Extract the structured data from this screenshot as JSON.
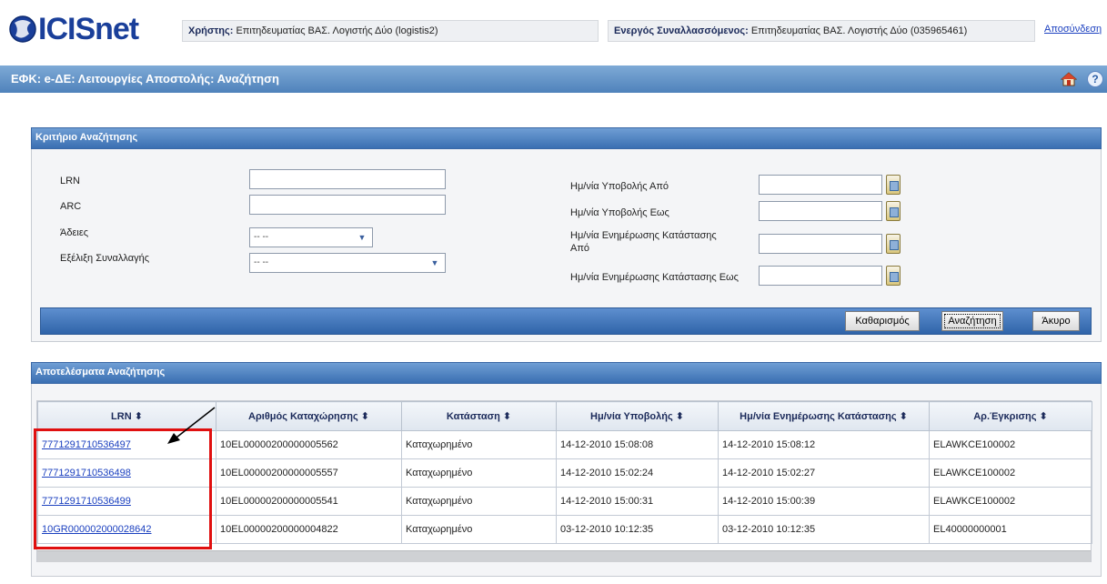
{
  "header": {
    "logo_text": "ICISnet",
    "user_label": "Χρήστης:",
    "user_value": "Επιτηδευματίας ΒΑΣ. Λογιστής Δύο (logistis2)",
    "trader_label": "Ενεργός Συναλλασσόμενος:",
    "trader_value": "Επιτηδευματίας ΒΑΣ. Λογιστής Δύο (035965461)",
    "logout": "Αποσύνδεση"
  },
  "titlebar": {
    "title": "ΕΦΚ: e-ΔΕ: Λειτουργίες Αποστολής: Αναζήτηση",
    "help": "?"
  },
  "criteria": {
    "heading": "Κριτήριο Αναζήτησης",
    "lrn_label": "LRN",
    "arc_label": "ARC",
    "permits_label": "Άδειες",
    "permits_value": "-- --",
    "progress_label": "Εξέλιξη Συναλλαγής",
    "progress_value": "-- --",
    "sub_from_label": "Ημ/νία Υποβολής Από",
    "sub_to_label": "Ημ/νία Υποβολής Εως",
    "upd_from_label": "Ημ/νία Ενημέρωσης Κατάστασης Από",
    "upd_to_label": "Ημ/νία Ενημέρωσης Κατάστασης Εως",
    "clear_button": "Καθαρισμός",
    "search_button": "Αναζήτηση",
    "cancel_button": "Άκυρο"
  },
  "results": {
    "heading": "Αποτελέσματα Αναζήτησης",
    "columns": [
      "LRN ⬍",
      "Αριθμός Καταχώρησης ⬍",
      "Κατάσταση ⬍",
      "Ημ/νία Υποβολής ⬍",
      "Ημ/νία Ενημέρωσης Κατάστασης ⬍",
      "Αρ.Έγκρισης ⬍"
    ],
    "rows": [
      [
        "7771291710536497",
        "10EL00000200000005562",
        "Καταχωρημένο",
        "14-12-2010 15:08:08",
        "14-12-2010 15:08:12",
        "ELAWKCE100002"
      ],
      [
        "7771291710536498",
        "10EL00000200000005557",
        "Καταχωρημένο",
        "14-12-2010 15:02:24",
        "14-12-2010 15:02:27",
        "ELAWKCE100002"
      ],
      [
        "7771291710536499",
        "10EL00000200000005541",
        "Καταχωρημένο",
        "14-12-2010 15:00:31",
        "14-12-2010 15:00:39",
        "ELAWKCE100002"
      ],
      [
        "10GR000002000028642",
        "10EL00000200000004822",
        "Καταχωρημένο",
        "03-12-2010 10:12:35",
        "03-12-2010 10:12:35",
        "EL40000000001"
      ]
    ]
  },
  "colors": {
    "header_blue": "#4f82bb",
    "link": "#1a3fbf",
    "highlight": "#e01010"
  }
}
